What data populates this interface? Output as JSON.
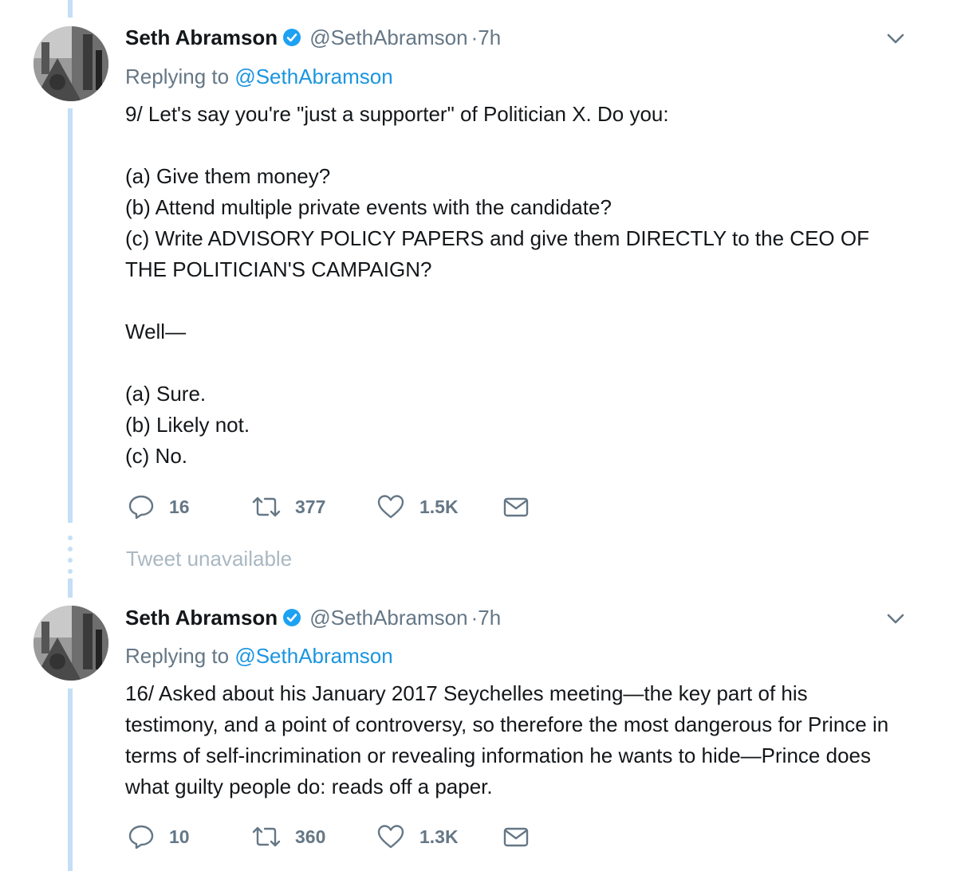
{
  "tweets": [
    {
      "author_name": "Seth Abramson",
      "handle": "@SethAbramson",
      "time": "·7h",
      "replying_prefix": "Replying to ",
      "replying_to": "@SethAbramson",
      "text": "9/ Let's say you're \"just a supporter\" of Politician X. Do you:\n\n(a) Give them money?\n(b) Attend multiple private events with the candidate?\n(c) Write ADVISORY POLICY PAPERS and give them DIRECTLY to the CEO OF THE POLITICIAN'S CAMPAIGN?\n\nWell—\n\n(a) Sure.\n(b) Likely not.\n(c) No.",
      "replies": "16",
      "retweets": "377",
      "likes": "1.5K"
    },
    {
      "author_name": "Seth Abramson",
      "handle": "@SethAbramson",
      "time": "·7h",
      "replying_prefix": "Replying to ",
      "replying_to": "@SethAbramson",
      "text": "16/ Asked about his January 2017 Seychelles meeting—the key part of his testimony, and a point of controversy, so therefore the most dangerous for Prince in terms of self-incrimination or revealing information he wants to hide—Prince does what guilty people do: reads off a paper.",
      "replies": "10",
      "retweets": "360",
      "likes": "1.3K"
    }
  ],
  "tweet_unavailable": "Tweet unavailable",
  "icons": [
    "verified-badge-icon",
    "chevron-down-icon",
    "reply-icon",
    "retweet-icon",
    "like-icon",
    "direct-message-icon"
  ],
  "colors": {
    "text": "#14171a",
    "secondary": "#657786",
    "link": "#1b95e0",
    "thread_line": "#c4dff6",
    "muted": "#aab8c2",
    "verified": "#1da1f2"
  }
}
